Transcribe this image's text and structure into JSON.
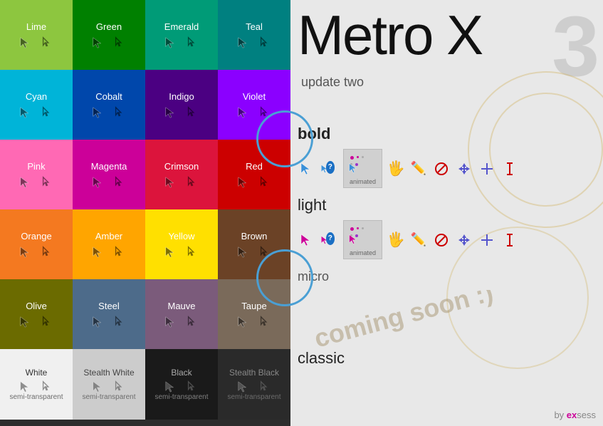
{
  "brand": {
    "title": "Metro X",
    "subtitle": "update two",
    "number": "3"
  },
  "sections": {
    "bold": "bold",
    "light": "light",
    "micro": "micro",
    "classic": "classic"
  },
  "animated_label": "animated",
  "coming_soon": "coming soon :)",
  "by_text": "by ",
  "ex_text": "ex",
  "sess_text": "sess",
  "colors": [
    {
      "name": "Lime",
      "class": "lime"
    },
    {
      "name": "Green",
      "class": "green"
    },
    {
      "name": "Emerald",
      "class": "emerald"
    },
    {
      "name": "Teal",
      "class": "teal"
    },
    {
      "name": "Cyan",
      "class": "cyan"
    },
    {
      "name": "Cobalt",
      "class": "cobalt"
    },
    {
      "name": "Indigo",
      "class": "indigo"
    },
    {
      "name": "Violet",
      "class": "violet"
    },
    {
      "name": "Pink",
      "class": "pink"
    },
    {
      "name": "Magenta",
      "class": "magenta"
    },
    {
      "name": "Crimson",
      "class": "crimson"
    },
    {
      "name": "Red",
      "class": "red"
    },
    {
      "name": "Orange",
      "class": "orange"
    },
    {
      "name": "Amber",
      "class": "amber"
    },
    {
      "name": "Yellow",
      "class": "yellow"
    },
    {
      "name": "Brown",
      "class": "brown"
    },
    {
      "name": "Olive",
      "class": "olive"
    },
    {
      "name": "Steel",
      "class": "steel"
    },
    {
      "name": "Mauve",
      "class": "mauve"
    },
    {
      "name": "Taupe",
      "class": "taupe"
    }
  ],
  "bottom_colors": [
    {
      "name": "White",
      "class": "white-cell",
      "text_color": "#333"
    },
    {
      "name": "Stealth White",
      "class": "stealth-white",
      "text_color": "#444"
    },
    {
      "name": "Black",
      "class": "black-cell",
      "text_color": "#aaa"
    },
    {
      "name": "Stealth Black",
      "class": "stealth-black",
      "text_color": "#888"
    }
  ]
}
